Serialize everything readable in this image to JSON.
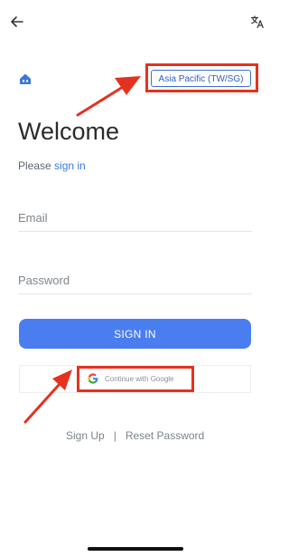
{
  "header": {
    "back_icon": "back-arrow-icon",
    "translate_icon": "translate-icon"
  },
  "region": {
    "label": "Asia Pacific (TW/SG)",
    "brand_icon": "home-icon",
    "accent_color": "#3b6fd6"
  },
  "welcome": {
    "title": "Welcome",
    "subtitle_prefix": "Please",
    "subtitle_link": "sign in"
  },
  "form": {
    "email_placeholder": "Email",
    "password_placeholder": "Password",
    "signin_label": "SIGN IN",
    "signin_color": "#4a7df0"
  },
  "google": {
    "label": "Continue with Google",
    "icon": "google-icon"
  },
  "links": {
    "signup": "Sign Up",
    "separator": "|",
    "reset": "Reset Password"
  },
  "annotation": {
    "highlight_color": "#e5321f"
  }
}
